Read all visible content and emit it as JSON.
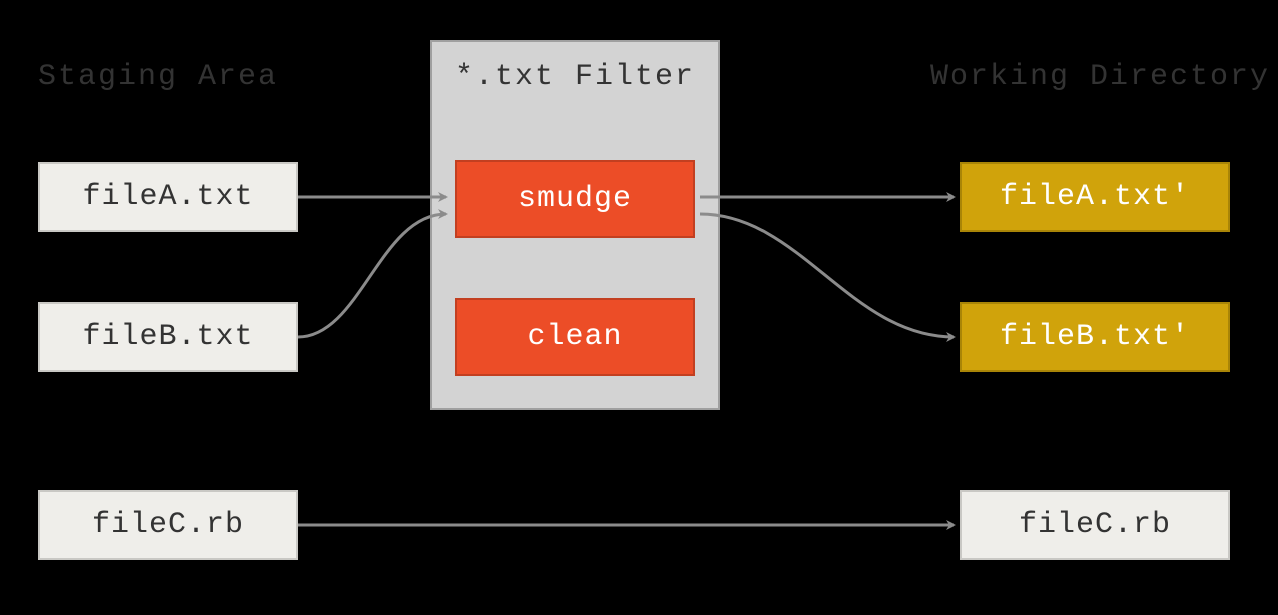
{
  "headers": {
    "staging": "Staging Area",
    "filter": "*.txt Filter",
    "working": "Working Directory"
  },
  "staging": {
    "fileA": "fileA.txt",
    "fileB": "fileB.txt",
    "fileC": "fileC.rb"
  },
  "filter": {
    "smudge": "smudge",
    "clean": "clean"
  },
  "working": {
    "fileA": "fileA.txt'",
    "fileB": "fileB.txt'",
    "fileC": "fileC.rb"
  },
  "colors": {
    "arrow": "#8b8b8b",
    "gold": "#d0a30b",
    "orange": "#ec4d27",
    "cream": "#efeeea"
  }
}
